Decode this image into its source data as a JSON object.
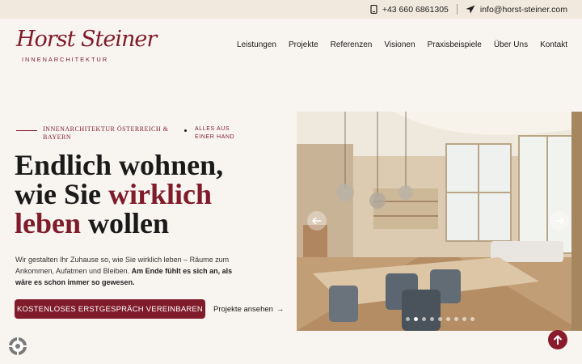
{
  "topbar": {
    "phone": "+43 660 6861305",
    "email": "info@horst-steiner.com",
    "phone_icon": "phone-icon",
    "email_icon": "send-icon"
  },
  "logo": {
    "script": "Horst Steiner",
    "subtitle": "INNENARCHITEKTUR"
  },
  "nav": {
    "items": [
      "Leistungen",
      "Projekte",
      "Referenzen",
      "Visionen",
      "Praxisbeispiele",
      "Über Uns",
      "Kontakt"
    ]
  },
  "hero": {
    "eyebrow_left": "INNENARCHITEKTUR ÖSTERREICH & BAYERN",
    "eyebrow_right": "ALLES AUS EINER HAND",
    "headline_1": "Endlich wohnen,",
    "headline_2a": "wie Sie ",
    "headline_2b": "wirklich",
    "headline_3a": "leben",
    "headline_3b": " wollen",
    "desc_plain": "Wir gestalten Ihr Zuhause so, wie Sie wirklich leben – Räume zum Ankommen, Aufatmen und Bleiben. ",
    "desc_bold": "Am Ende fühlt es sich an, als wäre es schon immer so gewesen.",
    "cta_label": "KOSTENLOSES ERSTGESPRÄCH VEREINBAREN",
    "projects_link": "Projekte ansehen",
    "projects_arrow": "→"
  },
  "slider": {
    "prev_icon": "arrow-left-icon",
    "next_icon": "arrow-right-icon",
    "slide_count": 9,
    "active_slide": 2,
    "image": "bright open-plan living room with dining table, pendant lights and large windows"
  },
  "colors": {
    "accent": "#7f1b2a",
    "topbar_bg": "#f1e9dd",
    "page_bg": "#f8f5f1"
  }
}
